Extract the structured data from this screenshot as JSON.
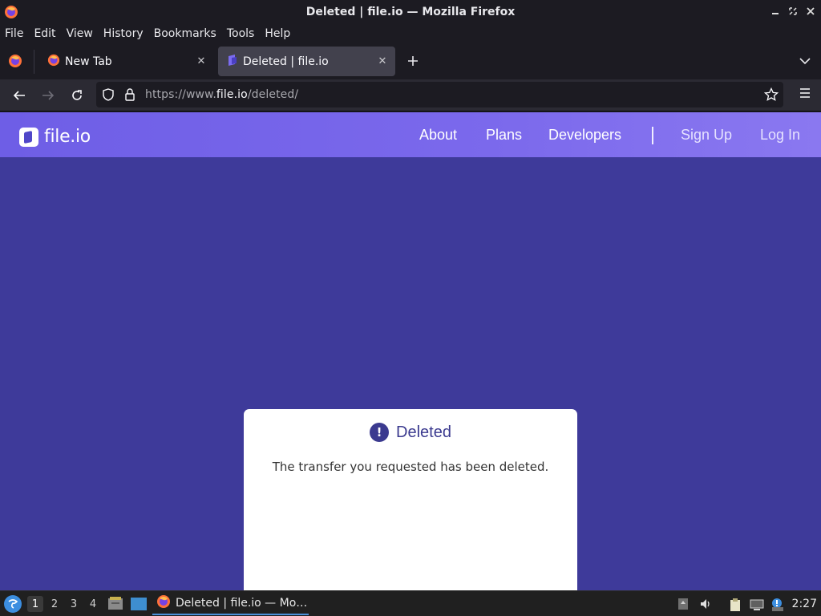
{
  "window": {
    "title": "Deleted | file.io — Mozilla Firefox"
  },
  "menubar": {
    "items": [
      "File",
      "Edit",
      "View",
      "History",
      "Bookmarks",
      "Tools",
      "Help"
    ]
  },
  "tabs": [
    {
      "label": "New Tab",
      "active": false
    },
    {
      "label": "Deleted | file.io",
      "active": true
    }
  ],
  "navbar": {
    "url_prefix": "https://www.",
    "url_domain": "file.io",
    "url_path": "/deleted/"
  },
  "site": {
    "logo_text": "file.io",
    "nav": {
      "about": "About",
      "plans": "Plans",
      "developers": "Developers",
      "sign_up": "Sign Up",
      "log_in": "Log In"
    },
    "card": {
      "icon_glyph": "!",
      "heading": "Deleted",
      "message": "The transfer you requested has been deleted."
    }
  },
  "taskbar": {
    "workspaces": [
      "1",
      "2",
      "3",
      "4"
    ],
    "active_workspace": "1",
    "app_label": "Deleted | file.io — Mo…",
    "clock": "2:27"
  },
  "colors": {
    "page_bg": "#3e3a9a",
    "header_gradient_start": "#6e5ee6",
    "accent": "#3b3a8f"
  }
}
